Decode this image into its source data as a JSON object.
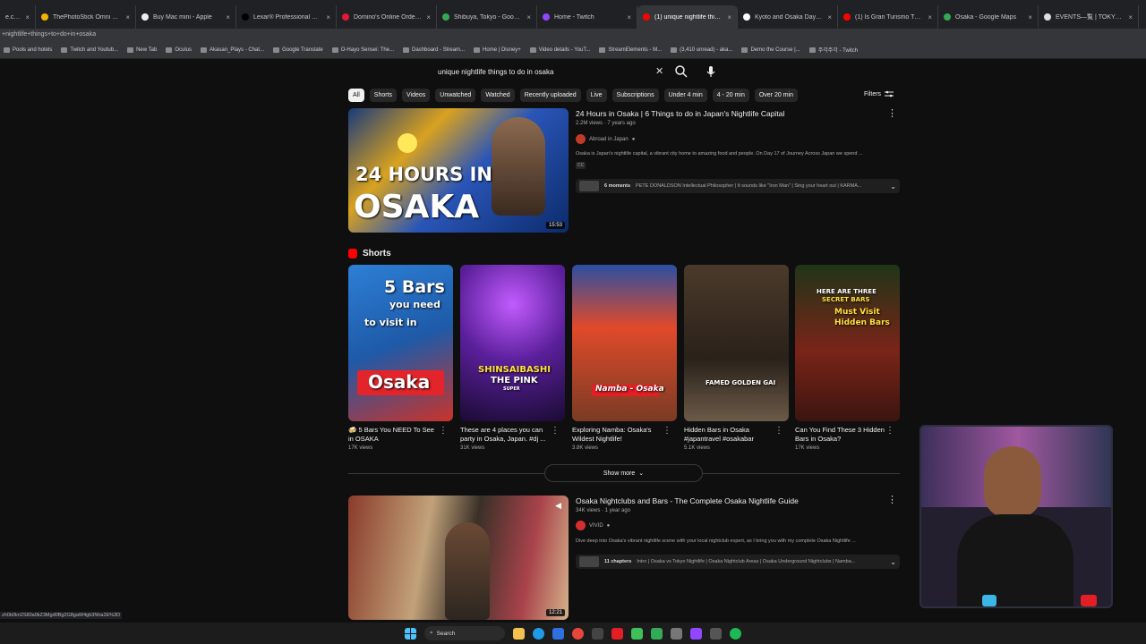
{
  "browser": {
    "tabs": [
      {
        "title": "e.co.jp",
        "color": "#aaaaaa"
      },
      {
        "title": "ThePhotoStick Omni 32GB, Pl",
        "color": "#f4b400"
      },
      {
        "title": "Buy Mac mini - Apple",
        "color": "#eeeeee"
      },
      {
        "title": "Lexar® Professional Go Porta",
        "color": "#000000"
      },
      {
        "title": "Domino's Online Ordering",
        "color": "#e31837"
      },
      {
        "title": "Shibuya, Tokyo - Google Map",
        "color": "#34a853"
      },
      {
        "title": "Home - Twitch",
        "color": "#9146ff"
      },
      {
        "title": "(1) unique nightlife things to",
        "color": "#ff0000"
      },
      {
        "title": "Kyoto and Osaka Day Trip | K",
        "color": "#ffffff"
      },
      {
        "title": "(1) Is Gran Turismo The Best",
        "color": "#ff0000"
      },
      {
        "title": "Osaka - Google Maps",
        "color": "#34a853"
      },
      {
        "title": "EVENTS—覧 | TOKYO TORCH",
        "color": "#dddddd"
      }
    ],
    "active_tab_index": 7,
    "address_fragment": "+nightlife+things+to+do+in+osaka",
    "bookmarks": [
      "Pools and hotels",
      "Twitch and Youtub...",
      "New Tab",
      "Oculus",
      "Akasan_Plays - Chat...",
      "Google Translate",
      "O-Hayo Sensei: The...",
      "Dashboard - Stream...",
      "Home | Disney+",
      "Video details - YouT...",
      "StreamElements - M...",
      "(3,410 unread) - aka...",
      "Demo the Course |...",
      "주각주각 - Twitch"
    ]
  },
  "search": {
    "query": "unique nightlife things to do in osaka",
    "clear_symbol": "✕"
  },
  "chips": [
    "All",
    "Shorts",
    "Videos",
    "Unwatched",
    "Watched",
    "Recently uploaded",
    "Live",
    "Subscriptions",
    "Under 4 min",
    "4 - 20 min",
    "Over 20 min"
  ],
  "filters_label": "Filters",
  "video1": {
    "title": "24 Hours in Osaka | 6 Things to do in Japan's Nightlife Capital",
    "meta": "2.2M views · 7 years ago",
    "channel": "Abroad in Japan",
    "description": "Osaka is Japan's nightlife capital, a vibrant city home to amazing food and people. On Day 17 of Journey Across Japan we spend ...",
    "cc": "CC",
    "moments_count": "6 moments",
    "moments_text": "PETE DONALDSON Intellectual Philosopher | It sounds like \"Iron Man\" | Sing your heart out | KARMA...",
    "duration": "15:53",
    "thumb_line1": "24 HOURS IN",
    "thumb_line2": "OSAKA"
  },
  "shorts_heading": "Shorts",
  "shorts": [
    {
      "title": "5 Bars You NEED To See in OSAKA",
      "prefix": "🍻",
      "views": "17K views",
      "ov1": "5 Bars",
      "ov2": "you need",
      "ov3": "to visit in",
      "ov4": "Osaka"
    },
    {
      "title": "These are 4 places you can party in Osaka, Japan. #dj ...",
      "views": "31K views",
      "ov1": "SHINSAIBASHI",
      "ov2": "THE PINK",
      "ov3": "SUPER"
    },
    {
      "title": "Exploring Namba: Osaka's Wildest Nightlife!",
      "views": "3.8K views",
      "ov1": "Namba - Osaka"
    },
    {
      "title": "Hidden Bars in Osaka #japantravel #osakabar",
      "views": "5.1K views",
      "ov1": "FAMED GOLDEN GAI"
    },
    {
      "title": "Can You Find These 3 Hidden Bars in Osaka?",
      "views": "17K views",
      "ov1": "HERE ARE THREE",
      "ov2": "SECRET BARS",
      "ov3": "Must Visit",
      "ov4": "Hidden Bars"
    }
  ],
  "show_more": "Show more",
  "video2": {
    "title": "Osaka Nightclubs and Bars - The Complete Osaka Nightlife Guide",
    "meta": "34K views · 1 year ago",
    "channel": "VIVID",
    "description": "Dive deep into Osaka's vibrant nightlife scene with your local nightclub expert, as I bring you with my complete Osaka Nightlife ...",
    "chapters_count": "11 chapters",
    "chapters_text": "Intro | Osaka vs Tokyo Nightlife | Osaka Nightclub Areas | Osaka Underground Nightclubs | Namba...",
    "duration": "12:21"
  },
  "status_url": "zh0b0kn2S80a0kZ3Mgd0Bg2G8gaW4gb3Nha2E%3D",
  "taskbar": {
    "search_label": "Search"
  }
}
